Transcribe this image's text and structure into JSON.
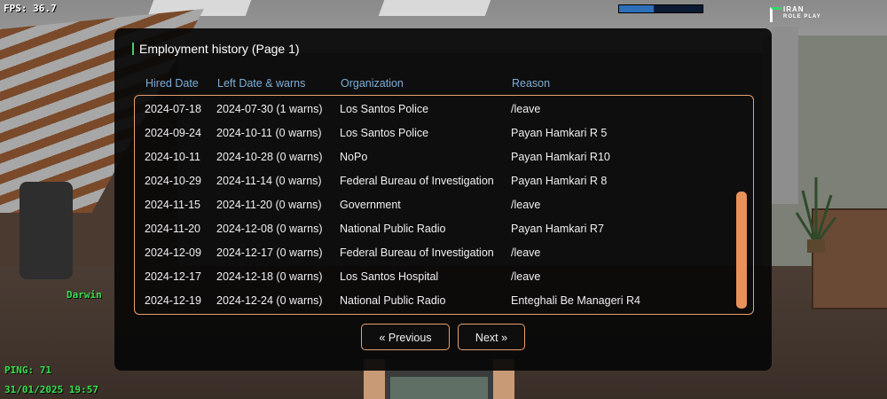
{
  "hud": {
    "fps": "FPS: 36.7",
    "ping": "PING: 71",
    "datetime": "31/01/2025 19:57",
    "player_tag": "Darwin",
    "logo_line1": "IRAN",
    "logo_line2": "ROLE PLAY",
    "top_bar_fraction": 0.41,
    "colors": {
      "hud_green": "#37e04f",
      "bar_fill": "#2e6fba"
    }
  },
  "dialog": {
    "title": "Employment history (Page 1)",
    "columns": [
      "Hired Date",
      "Left Date & warns",
      "Organization",
      "Reason"
    ],
    "rows": [
      [
        "2024-07-18",
        "2024-07-30 (1 warns)",
        "Los Santos Police",
        "/leave"
      ],
      [
        "2024-09-24",
        "2024-10-11 (0 warns)",
        "Los Santos Police",
        "Payan Hamkari R 5"
      ],
      [
        "2024-10-11",
        "2024-10-28 (0 warns)",
        "NoPo",
        "Payan Hamkari R10"
      ],
      [
        "2024-10-29",
        "2024-11-14 (0 warns)",
        "Federal Bureau of Investigation",
        "Payan Hamkari R 8"
      ],
      [
        "2024-11-15",
        "2024-11-20 (0 warns)",
        "Government",
        "/leave"
      ],
      [
        "2024-11-20",
        "2024-12-08 (0 warns)",
        "National Public Radio",
        "Payan Hamkari R7"
      ],
      [
        "2024-12-09",
        "2024-12-17 (0 warns)",
        "Federal Bureau of Investigation",
        "/leave"
      ],
      [
        "2024-12-17",
        "2024-12-18 (0 warns)",
        "Los Santos Hospital",
        "/leave"
      ],
      [
        "2024-12-19",
        "2024-12-24 (0 warns)",
        "National Public Radio",
        "Enteghali Be Manageri R4"
      ]
    ],
    "scroll": {
      "thumb_start_fraction": 0.44,
      "thumb_size_fraction": 0.56
    },
    "buttons": {
      "previous": "« Previous",
      "next": "Next »"
    },
    "colors": {
      "header_text": "#7eaed9",
      "accent_border": "#e7a06d",
      "scrollbar": "#e9915a",
      "title_accent": "#3bd36b"
    }
  }
}
